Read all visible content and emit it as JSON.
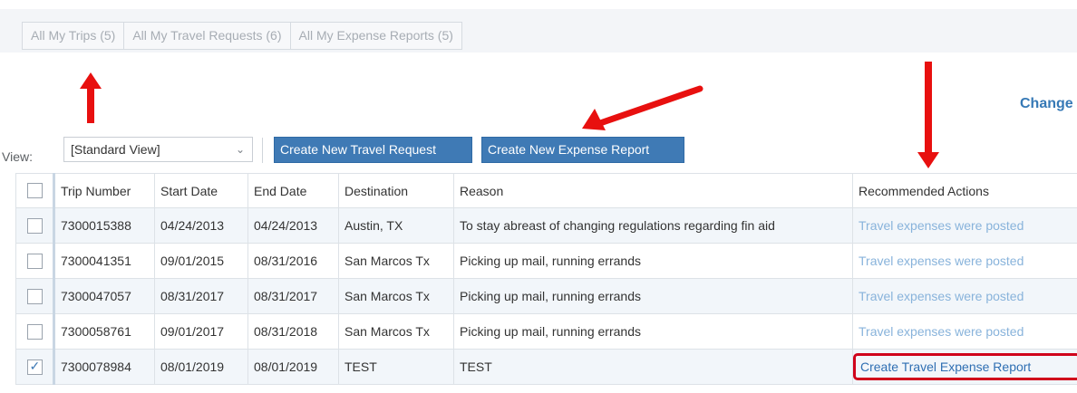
{
  "tabs": [
    {
      "label": "All My Trips (5)"
    },
    {
      "label": "All My Travel Requests (6)"
    },
    {
      "label": "All My Expense Reports (5)"
    }
  ],
  "change_link": "Change",
  "toolbar": {
    "view_label": "View:",
    "view_value": "[Standard View]",
    "create_travel_request": "Create New Travel Request",
    "create_expense_report": "Create New Expense Report"
  },
  "table": {
    "headers": {
      "trip_number": "Trip Number",
      "start_date": "Start Date",
      "end_date": "End Date",
      "destination": "Destination",
      "reason": "Reason",
      "recommended_actions": "Recommended Actions"
    },
    "rows": [
      {
        "trip": "7300015388",
        "start": "04/24/2013",
        "end": "04/24/2013",
        "destination": "Austin, TX",
        "reason": "To stay abreast of changing regulations regarding fin aid",
        "action": "Travel expenses were posted",
        "checked": false
      },
      {
        "trip": "7300041351",
        "start": "09/01/2015",
        "end": "08/31/2016",
        "destination": "San Marcos Tx",
        "reason": "Picking up mail, running errands",
        "action": "Travel expenses were posted",
        "checked": false
      },
      {
        "trip": "7300047057",
        "start": "08/31/2017",
        "end": "08/31/2017",
        "destination": "San Marcos Tx",
        "reason": "Picking up mail, running errands",
        "action": "Travel expenses were posted",
        "checked": false
      },
      {
        "trip": "7300058761",
        "start": "09/01/2017",
        "end": "08/31/2018",
        "destination": "San Marcos Tx",
        "reason": "Picking up mail, running errands",
        "action": "Travel expenses were posted",
        "checked": false
      },
      {
        "trip": "7300078984",
        "start": "08/01/2019",
        "end": "08/01/2019",
        "destination": "TEST",
        "reason": "TEST",
        "action": "Create Travel Expense Report",
        "checked": true
      }
    ]
  },
  "colors": {
    "button_bg": "#3f7ab5",
    "annotation_red": "#e8100f",
    "highlight_border": "#d0021b",
    "link_faded": "#88b3db",
    "link_strong": "#2f6fb3"
  }
}
